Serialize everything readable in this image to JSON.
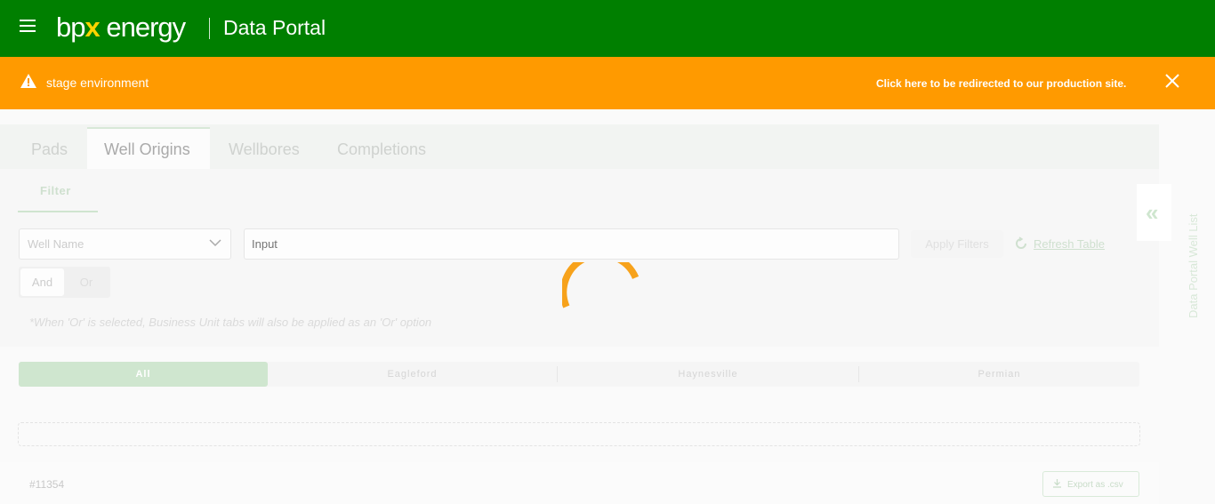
{
  "header": {
    "logo_prefix": "bp",
    "logo_x": "x",
    "logo_suffix": " energy",
    "portal_title": "Data Portal"
  },
  "banner": {
    "environment_text": "stage environment",
    "redirect_text": "Click here to be redirected to our production site.",
    "color": "#ff9a00"
  },
  "tabs": [
    {
      "label": "Pads"
    },
    {
      "label": "Well Origins",
      "active": true
    },
    {
      "label": "Wellbores"
    },
    {
      "label": "Completions"
    }
  ],
  "filter": {
    "tab_label": "Filter",
    "field_select_value": "Well Name",
    "input_placeholder": "Input",
    "apply_label": "Apply Filters",
    "refresh_label": "Refresh Table",
    "and_label": "And",
    "or_label": "Or",
    "note": "*When 'Or' is selected, Business Unit tabs will also be applied as an 'Or' option"
  },
  "business_units": [
    {
      "label": "All",
      "active": true
    },
    {
      "label": "Eagleford"
    },
    {
      "label": "Haynesville"
    },
    {
      "label": "Permian"
    }
  ],
  "footer": {
    "record_id": "#11354",
    "export_label": "Export as .csv"
  },
  "side_panel": {
    "label": "Data Portal Well List",
    "collapse_glyph": "«"
  },
  "colors": {
    "brand_green": "#007f00",
    "accent_yellow": "#ffd400",
    "spinner": "#f7a21b"
  }
}
